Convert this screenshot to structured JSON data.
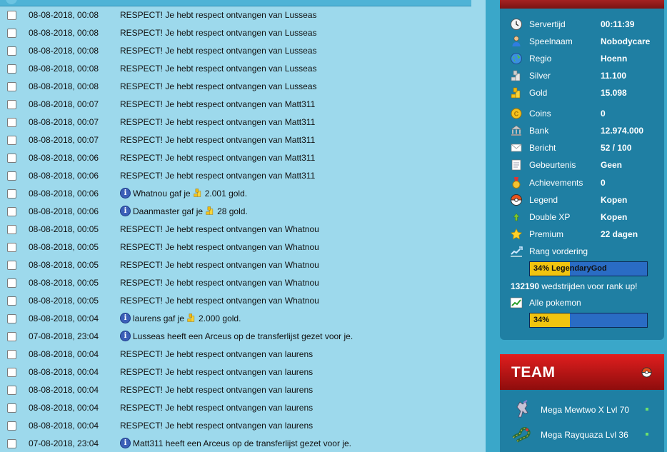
{
  "log": {
    "rows": [
      {
        "date": "08-08-2018, 00:08",
        "kind": "text",
        "text": "RESPECT! Je hebt respect ontvangen van Lusseas"
      },
      {
        "date": "08-08-2018, 00:08",
        "kind": "text",
        "text": "RESPECT! Je hebt respect ontvangen van Lusseas"
      },
      {
        "date": "08-08-2018, 00:08",
        "kind": "text",
        "text": "RESPECT! Je hebt respect ontvangen van Lusseas"
      },
      {
        "date": "08-08-2018, 00:08",
        "kind": "text",
        "text": "RESPECT! Je hebt respect ontvangen van Lusseas"
      },
      {
        "date": "08-08-2018, 00:08",
        "kind": "text",
        "text": "RESPECT! Je hebt respect ontvangen van Lusseas"
      },
      {
        "date": "08-08-2018, 00:07",
        "kind": "text",
        "text": "RESPECT! Je hebt respect ontvangen van Matt311"
      },
      {
        "date": "08-08-2018, 00:07",
        "kind": "text",
        "text": "RESPECT! Je hebt respect ontvangen van Matt311"
      },
      {
        "date": "08-08-2018, 00:07",
        "kind": "text",
        "text": "RESPECT! Je hebt respect ontvangen van Matt311"
      },
      {
        "date": "08-08-2018, 00:06",
        "kind": "text",
        "text": "RESPECT! Je hebt respect ontvangen van Matt311"
      },
      {
        "date": "08-08-2018, 00:06",
        "kind": "text",
        "text": "RESPECT! Je hebt respect ontvangen van Matt311"
      },
      {
        "date": "08-08-2018, 00:06",
        "kind": "gold",
        "before": "Whatnou gaf je",
        "after": "2.001 gold."
      },
      {
        "date": "08-08-2018, 00:06",
        "kind": "gold",
        "before": "Daanmaster gaf je",
        "after": "28 gold."
      },
      {
        "date": "08-08-2018, 00:05",
        "kind": "text",
        "text": "RESPECT! Je hebt respect ontvangen van Whatnou"
      },
      {
        "date": "08-08-2018, 00:05",
        "kind": "text",
        "text": "RESPECT! Je hebt respect ontvangen van Whatnou"
      },
      {
        "date": "08-08-2018, 00:05",
        "kind": "text",
        "text": "RESPECT! Je hebt respect ontvangen van Whatnou"
      },
      {
        "date": "08-08-2018, 00:05",
        "kind": "text",
        "text": "RESPECT! Je hebt respect ontvangen van Whatnou"
      },
      {
        "date": "08-08-2018, 00:05",
        "kind": "text",
        "text": "RESPECT! Je hebt respect ontvangen van Whatnou"
      },
      {
        "date": "08-08-2018, 00:04",
        "kind": "gold",
        "before": "laurens gaf je",
        "after": "2.000 gold."
      },
      {
        "date": "07-08-2018, 23:04",
        "kind": "info",
        "text": "Lusseas heeft een Arceus op de transferlijst gezet voor je."
      },
      {
        "date": "08-08-2018, 00:04",
        "kind": "text",
        "text": "RESPECT! Je hebt respect ontvangen van laurens"
      },
      {
        "date": "08-08-2018, 00:04",
        "kind": "text",
        "text": "RESPECT! Je hebt respect ontvangen van laurens"
      },
      {
        "date": "08-08-2018, 00:04",
        "kind": "text",
        "text": "RESPECT! Je hebt respect ontvangen van laurens"
      },
      {
        "date": "08-08-2018, 00:04",
        "kind": "text",
        "text": "RESPECT! Je hebt respect ontvangen van laurens"
      },
      {
        "date": "08-08-2018, 00:04",
        "kind": "text",
        "text": "RESPECT! Je hebt respect ontvangen van laurens"
      },
      {
        "date": "07-08-2018, 23:04",
        "kind": "info",
        "text": "Matt311 heeft een Arceus op de transferlijst gezet voor je."
      }
    ]
  },
  "stats": {
    "servertijd": {
      "label": "Servertijd",
      "value": "00:11:39",
      "icon": "clock-icon"
    },
    "speelnaam": {
      "label": "Speelnaam",
      "value": "Nobodycare",
      "icon": "user-icon"
    },
    "regio": {
      "label": "Regio",
      "value": "Hoenn",
      "icon": "globe-icon"
    },
    "silver": {
      "label": "Silver",
      "value": "11.100",
      "icon": "silver-coins-icon"
    },
    "gold": {
      "label": "Gold",
      "value": "15.098",
      "icon": "gold-coins-icon"
    },
    "coins": {
      "label": "Coins",
      "value": "0",
      "icon": "coin-icon"
    },
    "bank": {
      "label": "Bank",
      "value": "12.974.000",
      "icon": "bank-icon"
    },
    "bericht": {
      "label": "Bericht",
      "value": "52 / 100",
      "icon": "envelope-icon"
    },
    "gebeurtenis": {
      "label": "Gebeurtenis",
      "value": "Geen",
      "icon": "notepad-icon"
    },
    "achievements": {
      "label": "Achievements",
      "value": "0",
      "icon": "medal-icon"
    },
    "legend": {
      "label": "Legend",
      "value": "Kopen",
      "icon": "pokeball-icon"
    },
    "double_xp": {
      "label": "Double XP",
      "value": "Kopen",
      "icon": "arrow-up-icon"
    },
    "premium": {
      "label": "Premium",
      "value": "22 dagen",
      "icon": "star-icon"
    },
    "rang": {
      "label": "Rang vordering",
      "icon": "chart-icon",
      "progress": 0.34,
      "bar_text": "34% LegendaryGod"
    },
    "wedstrijden": {
      "number": "132190",
      "text": " wedstrijden voor rank up!"
    },
    "alle_pokemon": {
      "label": "Alle pokemon",
      "icon": "chart-green-icon",
      "progress": 0.34,
      "bar_text": "34%"
    }
  },
  "team": {
    "title": "TEAM",
    "members": [
      {
        "name": "Mega Mewtwo X Lvl 70"
      },
      {
        "name": "Mega Rayquaza  Lvl 36"
      }
    ]
  },
  "colors": {
    "log_bg": "#9dd9ec",
    "panel_bg": "#1f7fa3",
    "page_bg": "#3aa7c9",
    "team_header": "#d21a1a",
    "bar_fill": "#f1c40f",
    "bar_bg": "#2a6cc4"
  }
}
